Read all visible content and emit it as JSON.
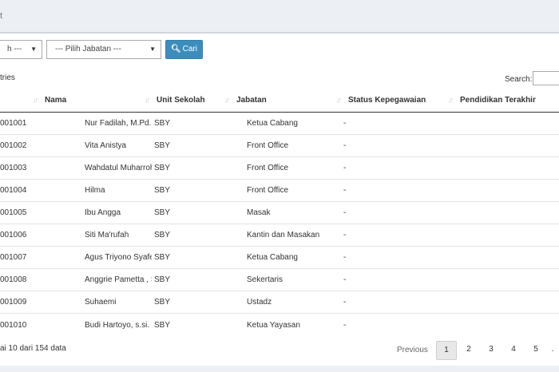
{
  "breadcrumb": {
    "text": "t"
  },
  "filters": {
    "select1_value": "h ---",
    "select2_value": "--- Pilih Jabatan ---",
    "search_button_label": "Cari"
  },
  "table_controls": {
    "entries_text": "tries",
    "search_label": "Search:"
  },
  "table": {
    "headers": [
      "Nama",
      "Unit Sekolah",
      "Jabatan",
      "Status Kepegawaian",
      "Pendidikan Terakhir"
    ],
    "rows": [
      {
        "no": "001001",
        "nama": "Nur Fadilah, M.Pd.I",
        "unit": "SBY",
        "jabatan": "Ketua Cabang",
        "status": "-"
      },
      {
        "no": "001002",
        "nama": "Vita Anistya",
        "unit": "SBY",
        "jabatan": "Front Office",
        "status": "-"
      },
      {
        "no": "001003",
        "nama": "Wahdatul Muharrohmah",
        "unit": "SBY",
        "jabatan": "Front Office",
        "status": "-"
      },
      {
        "no": "001004",
        "nama": "Hilma",
        "unit": "SBY",
        "jabatan": "Front Office",
        "status": "-"
      },
      {
        "no": "001005",
        "nama": "Ibu Angga",
        "unit": "SBY",
        "jabatan": "Masak",
        "status": "-"
      },
      {
        "no": "001006",
        "nama": "Siti Ma'rufah",
        "unit": "SBY",
        "jabatan": "Kantin dan Masakan",
        "status": "-"
      },
      {
        "no": "001007",
        "nama": "Agus Triyono Syafe'I, S.Psi",
        "unit": "SBY",
        "jabatan": "Ketua Cabang",
        "status": "-"
      },
      {
        "no": "001008",
        "nama": "Anggrie Pametta , S.Pd.I",
        "unit": "SBY",
        "jabatan": "Sekertaris",
        "status": "-"
      },
      {
        "no": "001009",
        "nama": "Suhaemi",
        "unit": "SBY",
        "jabatan": "Ustadz",
        "status": "-"
      },
      {
        "no": "001010",
        "nama": "Budi Hartoyo, s.si. M.Ag",
        "unit": "SBY",
        "jabatan": "Ketua Yayasan",
        "status": "-"
      }
    ]
  },
  "footer": {
    "info_text": "ai 10 dari 154 data",
    "pagination": {
      "previous": "Previous",
      "pages": [
        "1",
        "2",
        "3",
        "4",
        "5"
      ],
      "active": "1",
      "ellipsis": "."
    }
  },
  "colors": {
    "primary_button": "#3c8dbc",
    "page_background": "#ecf0f5"
  },
  "icons": {
    "search_button_icon": "search-icon",
    "sort_icon": "sort-arrows-icon"
  }
}
